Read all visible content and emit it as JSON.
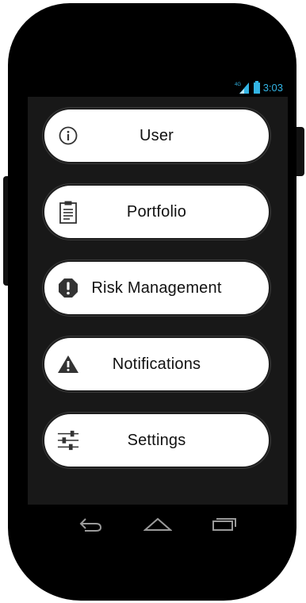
{
  "status_bar": {
    "network": "4G",
    "time": "3:03",
    "accent_color": "#33b5e5"
  },
  "menu": {
    "items": [
      {
        "label": "User",
        "icon": "info-icon"
      },
      {
        "label": "Portfolio",
        "icon": "clipboard-icon"
      },
      {
        "label": "Risk Management",
        "icon": "alert-octagon-icon"
      },
      {
        "label": "Notifications",
        "icon": "warning-triangle-icon"
      },
      {
        "label": "Settings",
        "icon": "sliders-icon"
      }
    ]
  },
  "nav": {
    "back": "back-icon",
    "home": "home-icon",
    "recents": "recents-icon"
  }
}
